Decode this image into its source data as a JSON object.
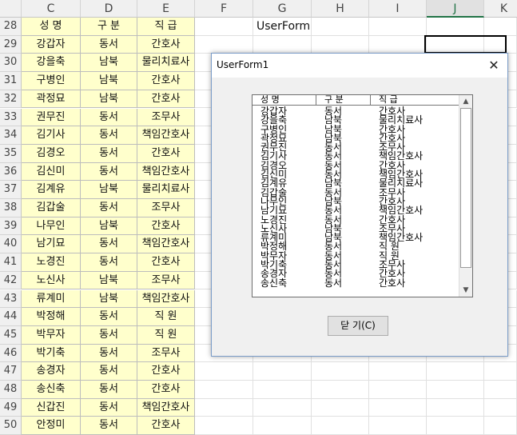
{
  "columns": [
    "C",
    "D",
    "E",
    "F",
    "G",
    "H",
    "I",
    "J",
    "K"
  ],
  "active_column": "J",
  "rows": [
    {
      "num": "28",
      "c": "성 명",
      "d": "구 분",
      "e": "직 급"
    },
    {
      "num": "29",
      "c": "강갑자",
      "d": "동서",
      "e": "간호사"
    },
    {
      "num": "30",
      "c": "강을축",
      "d": "남북",
      "e": "물리치료사"
    },
    {
      "num": "31",
      "c": "구병인",
      "d": "남북",
      "e": "간호사"
    },
    {
      "num": "32",
      "c": "곽정묘",
      "d": "남북",
      "e": "간호사"
    },
    {
      "num": "33",
      "c": "권무진",
      "d": "동서",
      "e": "조무사"
    },
    {
      "num": "34",
      "c": "김기사",
      "d": "동서",
      "e": "책임간호사"
    },
    {
      "num": "35",
      "c": "김경오",
      "d": "동서",
      "e": "간호사"
    },
    {
      "num": "36",
      "c": "김신미",
      "d": "동서",
      "e": "책임간호사"
    },
    {
      "num": "37",
      "c": "김계유",
      "d": "남북",
      "e": "물리치료사"
    },
    {
      "num": "38",
      "c": "김갑술",
      "d": "동서",
      "e": "조무사"
    },
    {
      "num": "39",
      "c": "나무인",
      "d": "남북",
      "e": "간호사"
    },
    {
      "num": "40",
      "c": "남기묘",
      "d": "동서",
      "e": "책임간호사"
    },
    {
      "num": "41",
      "c": "노경진",
      "d": "동서",
      "e": "간호사"
    },
    {
      "num": "42",
      "c": "노신사",
      "d": "남북",
      "e": "조무사"
    },
    {
      "num": "43",
      "c": "류계미",
      "d": "남북",
      "e": "책임간호사"
    },
    {
      "num": "44",
      "c": "박정해",
      "d": "동서",
      "e": "직 원"
    },
    {
      "num": "45",
      "c": "박무자",
      "d": "동서",
      "e": "직 원"
    },
    {
      "num": "46",
      "c": "박기축",
      "d": "동서",
      "e": "조무사"
    },
    {
      "num": "47",
      "c": "송경자",
      "d": "동서",
      "e": "간호사"
    },
    {
      "num": "48",
      "c": "송신축",
      "d": "동서",
      "e": "간호사"
    },
    {
      "num": "49",
      "c": "신갑진",
      "d": "동서",
      "e": "책임간호사"
    },
    {
      "num": "50",
      "c": "안정미",
      "d": "동서",
      "e": "간호사"
    }
  ],
  "g28": "UserForm",
  "dialog": {
    "title": "UserForm1",
    "close_glyph": "✕",
    "list_headers": [
      "성 명",
      "구 분",
      "직 급"
    ],
    "list_rows": [
      [
        "강갑자",
        "동서",
        "간호사"
      ],
      [
        "강을축",
        "남북",
        "물리치료사"
      ],
      [
        "구병인",
        "남북",
        "간호사"
      ],
      [
        "곽정묘",
        "남북",
        "간호사"
      ],
      [
        "권무진",
        "동서",
        "조무사"
      ],
      [
        "김기사",
        "동서",
        "책임간호사"
      ],
      [
        "김경오",
        "동서",
        "간호사"
      ],
      [
        "김신미",
        "동서",
        "책임간호사"
      ],
      [
        "김계유",
        "남북",
        "물리치료사"
      ],
      [
        "김갑술",
        "동서",
        "조무사"
      ],
      [
        "나무인",
        "남북",
        "간호사"
      ],
      [
        "남기묘",
        "동서",
        "책임간호사"
      ],
      [
        "노경진",
        "동서",
        "간호사"
      ],
      [
        "노신사",
        "남북",
        "조무사"
      ],
      [
        "류계미",
        "남북",
        "책임간호사"
      ],
      [
        "박정해",
        "동서",
        "직 원"
      ],
      [
        "박무자",
        "동서",
        "직 원"
      ],
      [
        "박기축",
        "동서",
        "조무사"
      ],
      [
        "송경자",
        "동서",
        "간호사"
      ],
      [
        "송신축",
        "동서",
        "간호사"
      ]
    ],
    "close_button": "닫 기(C)",
    "scroll_up": "▲",
    "scroll_down": "▼"
  },
  "colors": {
    "highlight": "#ffffcc",
    "excel_green": "#217346"
  }
}
